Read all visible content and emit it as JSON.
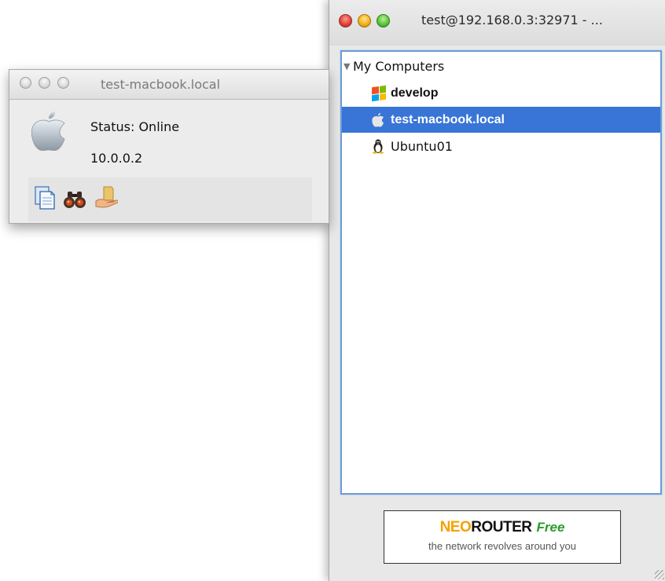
{
  "main_window": {
    "title": "test@192.168.0.3:32971 - ...",
    "tree": {
      "root_label": "My Computers",
      "items": [
        {
          "label": "develop",
          "icon": "windows-icon",
          "selected": false
        },
        {
          "label": "test-macbook.local",
          "icon": "apple-icon",
          "selected": true
        },
        {
          "label": "Ubuntu01",
          "icon": "linux-tux-icon",
          "selected": false
        }
      ]
    },
    "banner": {
      "brand_neo": "NEO",
      "brand_router": "ROUTER",
      "edition": "Free",
      "tagline": "the network revolves around you"
    }
  },
  "detail_window": {
    "title": "test-macbook.local",
    "status": "Status: Online",
    "ip": "10.0.0.2",
    "actions": [
      {
        "icon": "document-icon"
      },
      {
        "icon": "binoculars-icon"
      },
      {
        "icon": "shared-folder-icon"
      }
    ]
  },
  "colors": {
    "selection": "#3875d7",
    "brand_orange": "#f5a200",
    "brand_green": "#2b9b2b"
  }
}
